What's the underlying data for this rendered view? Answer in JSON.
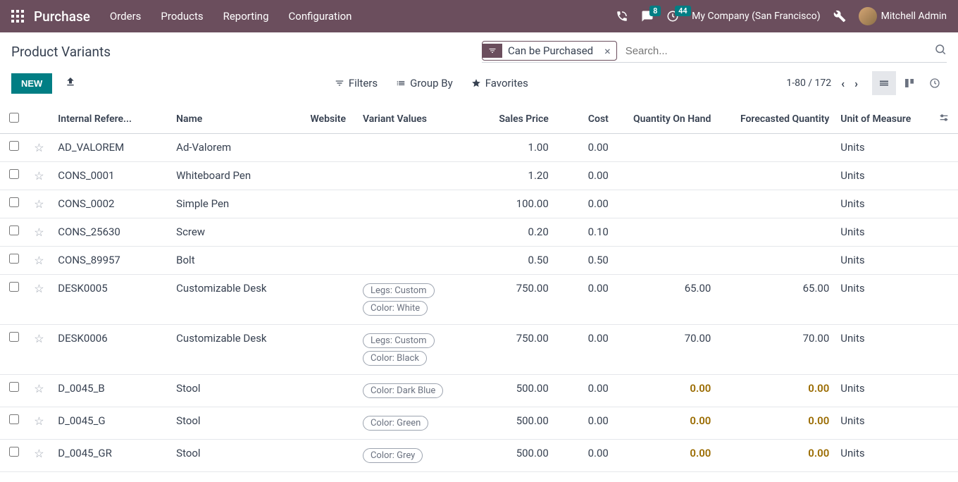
{
  "topbar": {
    "app_name": "Purchase",
    "menu": [
      "Orders",
      "Products",
      "Reporting",
      "Configuration"
    ],
    "messages_badge": "8",
    "activities_badge": "44",
    "company": "My Company (San Francisco)",
    "user": "Mitchell Admin"
  },
  "breadcrumb": "Product Variants",
  "search": {
    "filter_label": "Can be Purchased",
    "placeholder": "Search..."
  },
  "buttons": {
    "new": "NEW",
    "filters": "Filters",
    "groupby": "Group By",
    "favorites": "Favorites"
  },
  "pager": {
    "range": "1-80 / 172"
  },
  "columns": {
    "ref": "Internal Refere...",
    "name": "Name",
    "website": "Website",
    "variants": "Variant Values",
    "sales_price": "Sales Price",
    "cost": "Cost",
    "qoh": "Quantity On Hand",
    "forecast": "Forecasted Quantity",
    "uom": "Unit of Measure"
  },
  "rows": [
    {
      "ref": "AD_VALOREM",
      "name": "Ad-Valorem",
      "variants": [],
      "sales_price": "1.00",
      "cost": "0.00",
      "qoh": "",
      "forecast": "",
      "uom": "Units",
      "warn": false
    },
    {
      "ref": "CONS_0001",
      "name": "Whiteboard Pen",
      "variants": [],
      "sales_price": "1.20",
      "cost": "0.00",
      "qoh": "",
      "forecast": "",
      "uom": "Units",
      "warn": false
    },
    {
      "ref": "CONS_0002",
      "name": "Simple Pen",
      "variants": [],
      "sales_price": "100.00",
      "cost": "0.00",
      "qoh": "",
      "forecast": "",
      "uom": "Units",
      "warn": false
    },
    {
      "ref": "CONS_25630",
      "name": "Screw",
      "variants": [],
      "sales_price": "0.20",
      "cost": "0.10",
      "qoh": "",
      "forecast": "",
      "uom": "Units",
      "warn": false
    },
    {
      "ref": "CONS_89957",
      "name": "Bolt",
      "variants": [],
      "sales_price": "0.50",
      "cost": "0.50",
      "qoh": "",
      "forecast": "",
      "uom": "Units",
      "warn": false
    },
    {
      "ref": "DESK0005",
      "name": "Customizable Desk",
      "variants": [
        "Legs: Custom",
        "Color: White"
      ],
      "sales_price": "750.00",
      "cost": "0.00",
      "qoh": "65.00",
      "forecast": "65.00",
      "uom": "Units",
      "warn": false
    },
    {
      "ref": "DESK0006",
      "name": "Customizable Desk",
      "variants": [
        "Legs: Custom",
        "Color: Black"
      ],
      "sales_price": "750.00",
      "cost": "0.00",
      "qoh": "70.00",
      "forecast": "70.00",
      "uom": "Units",
      "warn": false
    },
    {
      "ref": "D_0045_B",
      "name": "Stool",
      "variants": [
        "Color: Dark Blue"
      ],
      "sales_price": "500.00",
      "cost": "0.00",
      "qoh": "0.00",
      "forecast": "0.00",
      "uom": "Units",
      "warn": true
    },
    {
      "ref": "D_0045_G",
      "name": "Stool",
      "variants": [
        "Color: Green"
      ],
      "sales_price": "500.00",
      "cost": "0.00",
      "qoh": "0.00",
      "forecast": "0.00",
      "uom": "Units",
      "warn": true
    },
    {
      "ref": "D_0045_GR",
      "name": "Stool",
      "variants": [
        "Color: Grey"
      ],
      "sales_price": "500.00",
      "cost": "0.00",
      "qoh": "0.00",
      "forecast": "0.00",
      "uom": "Units",
      "warn": true
    }
  ]
}
